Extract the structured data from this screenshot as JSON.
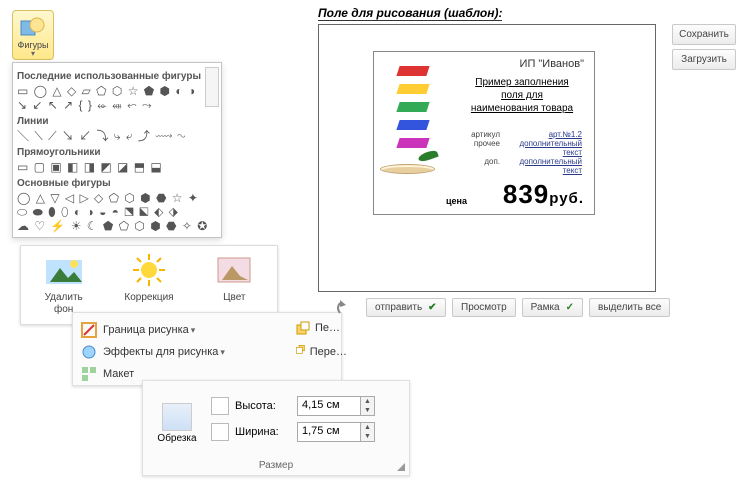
{
  "shapes_button": {
    "label": "Фигуры"
  },
  "gallery": {
    "section_recent": "Последние использованные фигуры",
    "section_lines": "Линии",
    "section_rects": "Прямоугольники",
    "section_basic": "Основные фигуры"
  },
  "ribbon1": {
    "remove_bg_l1": "Удалить",
    "remove_bg_l2": "фон",
    "corrections": "Коррекция",
    "color": "Цвет"
  },
  "ribbon2": {
    "border": "Граница рисунка",
    "effects": "Эффекты для рисунка",
    "layout": "Макет",
    "bring1": "Пе…",
    "bring2": "Пере…"
  },
  "size_panel": {
    "crop": "Обрезка",
    "height_label": "Высота:",
    "height_value": "4,15 см",
    "width_label": "Ширина:",
    "width_value": "1,75 см",
    "group": "Размер"
  },
  "canvas": {
    "title": "Поле для рисования (шаблон):",
    "send": "отправить",
    "preview": "Просмотр",
    "frame": "Рамка",
    "select_all": "выделить все"
  },
  "right_buttons": {
    "save": "Сохранить",
    "load": "Загрузить"
  },
  "label": {
    "org": "ИП \"Иванов\"",
    "prod_l1": "Пример заполнения",
    "prod_l2": "поля для",
    "prod_l3": "наименования товара",
    "article_k": "артикул",
    "article_v": "арт.№1.2",
    "other_k": "прочее",
    "other_v": "дополнительный текст",
    "extra_k": "доп.",
    "extra_v": "дополнительный текст",
    "price_label": "цена",
    "price_value": "839",
    "currency": "руб."
  }
}
